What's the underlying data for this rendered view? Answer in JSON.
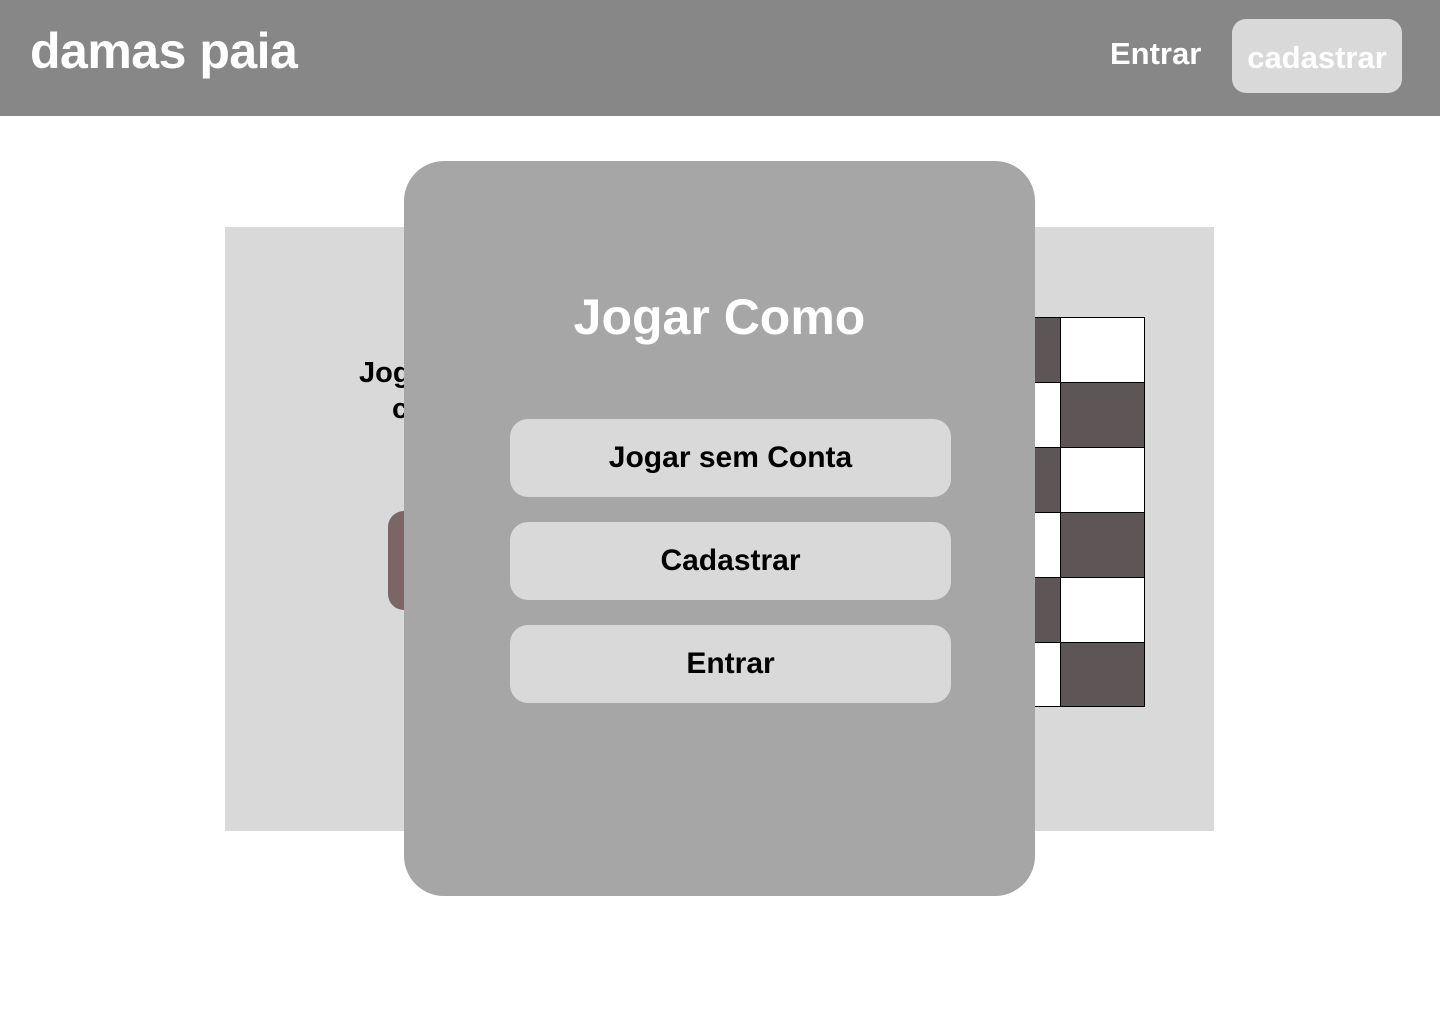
{
  "header": {
    "brand": "damas paia",
    "login_label": "Entrar",
    "signup_label": "cadastrar"
  },
  "background": {
    "partial_text_line1": "Jog",
    "partial_text_line2": "c"
  },
  "modal": {
    "title": "Jogar Como",
    "buttons": [
      {
        "label": "Jogar sem Conta"
      },
      {
        "label": "Cadastrar"
      },
      {
        "label": "Entrar"
      }
    ]
  },
  "colors": {
    "header_bg": "#878787",
    "panel_bg": "#d9d9d9",
    "modal_bg": "#a6a6a6",
    "board_dark": "#5e5656",
    "accent_button": "#7b6565"
  }
}
